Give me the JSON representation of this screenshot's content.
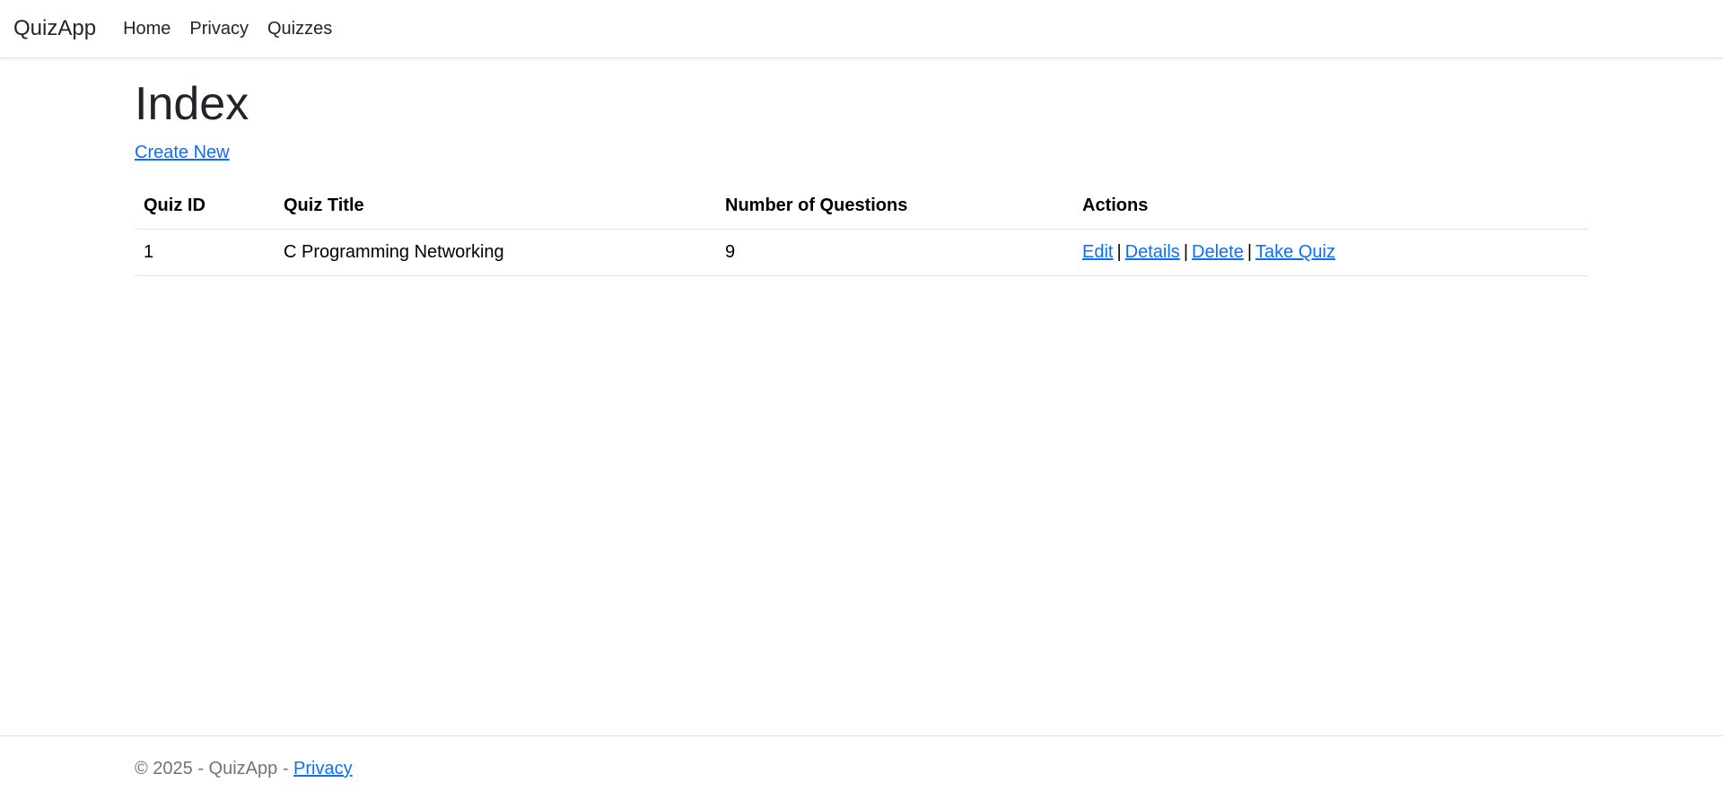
{
  "navbar": {
    "brand": "QuizApp",
    "links": [
      "Home",
      "Privacy",
      "Quizzes"
    ]
  },
  "main": {
    "title": "Index",
    "create_link": "Create New",
    "table": {
      "headers": [
        "Quiz ID",
        "Quiz Title",
        "Number of Questions",
        "Actions"
      ],
      "rows": [
        {
          "id": "1",
          "title": "C Programming Networking",
          "num_questions": "9",
          "actions": [
            "Edit",
            "Details",
            "Delete",
            "Take Quiz"
          ]
        }
      ],
      "separator": "|"
    }
  },
  "footer": {
    "text": "© 2025 - QuizApp -",
    "privacy_link": "Privacy"
  },
  "colors": {
    "link": "#0d6efd",
    "text": "#212529",
    "muted": "#6c757d",
    "border": "#dee2e6"
  }
}
